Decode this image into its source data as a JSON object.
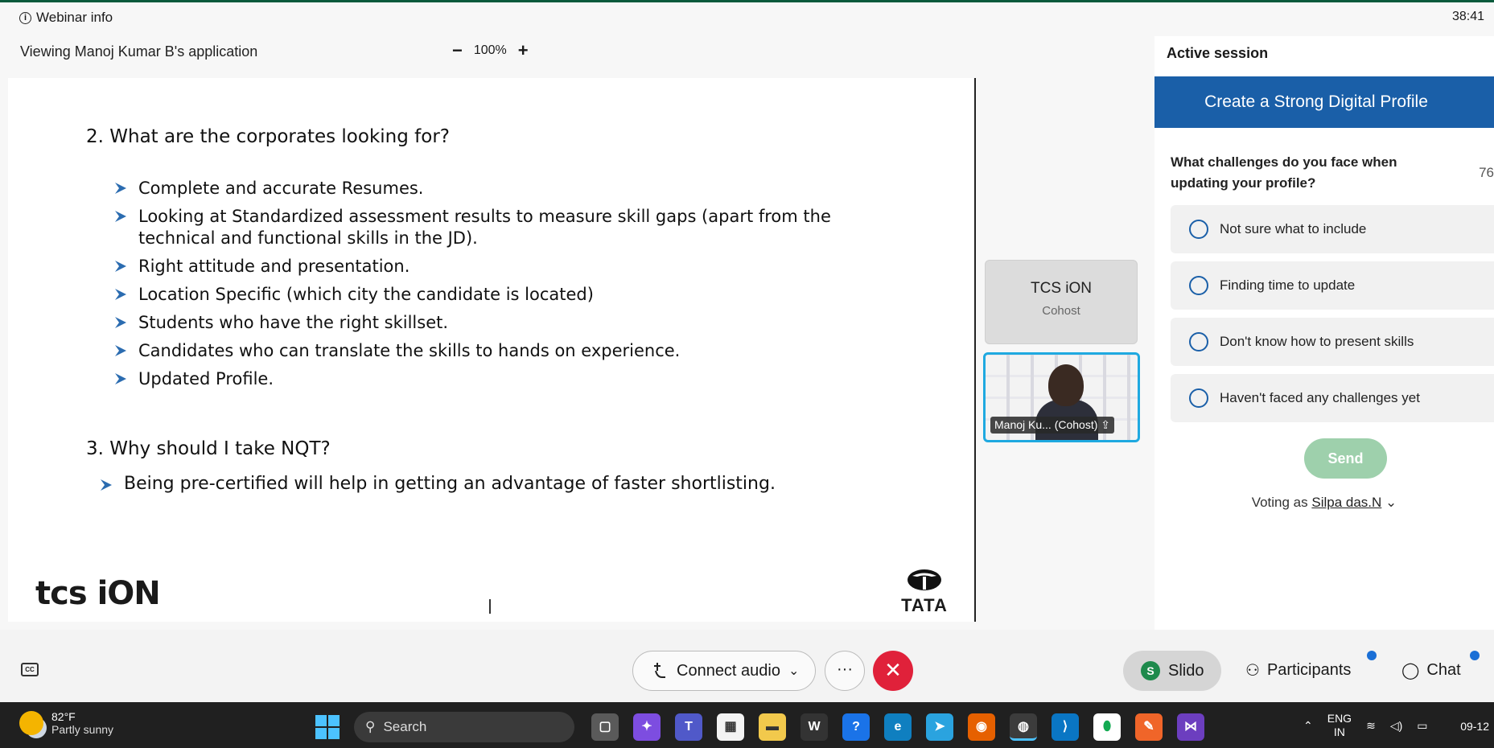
{
  "topbar": {
    "webinar_info": "Webinar info",
    "timer": "38:41"
  },
  "viewing": {
    "text": "Viewing Manoj Kumar B's application",
    "zoom_minus": "−",
    "zoom_level": "100%",
    "zoom_plus": "+"
  },
  "slide": {
    "section2_title": "2. What are the corporates looking for?",
    "bullets": [
      "Complete and accurate Resumes.",
      "Looking at Standardized assessment results to measure skill gaps (apart from the technical and functional skills in the JD).",
      "Right attitude and presentation.",
      "Location Specific (which city the candidate is located)",
      "Students who have the right skillset.",
      "Candidates who can translate the skills to hands on experience.",
      "Updated Profile."
    ],
    "section3_title": "3.  Why should I take NQT?",
    "section3_bullet": "Being pre-certified will help in getting an advantage of faster shortlisting.",
    "logo_left": "tcs iON",
    "logo_right": "TATA"
  },
  "participants": {
    "cohost_name": "TCS iON",
    "cohost_role": "Cohost",
    "video_label": "Manoj Ku... (Cohost)"
  },
  "panel": {
    "title": "Active session",
    "poll_title": "Create a Strong Digital Profile",
    "question": "What challenges do you face when updating your profile?",
    "count": "76",
    "options": [
      "Not sure what to include",
      "Finding time to update",
      "Don't know how to present skills",
      "Haven't faced any challenges yet"
    ],
    "send": "Send",
    "voting_prefix": "Voting as",
    "voting_user": "Silpa das.N"
  },
  "controls": {
    "connect_audio": "Connect audio",
    "more": "···",
    "end": "✕",
    "slido": "Slido",
    "participants": "Participants",
    "chat": "Chat"
  },
  "taskbar": {
    "temp": "82°F",
    "weather": "Partly sunny",
    "search": "Search",
    "lang_line1": "ENG",
    "lang_line2": "IN",
    "date": "09-12"
  },
  "colors": {
    "accent_blue": "#1a5fa8",
    "end_red": "#e0213a",
    "send_green": "#9ed0ac",
    "slido_green": "#1e8a4c"
  }
}
